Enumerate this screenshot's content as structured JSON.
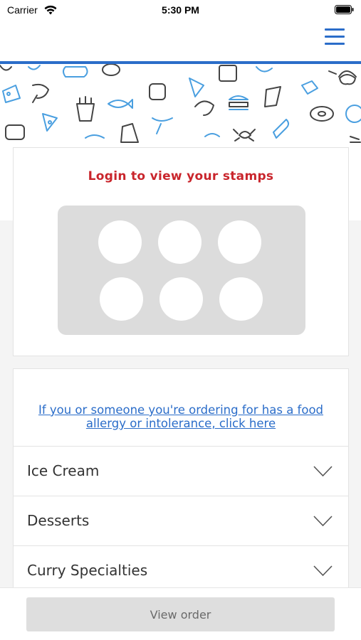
{
  "status_bar": {
    "carrier": "Carrier",
    "time": "5:30 PM",
    "wifi_icon": "wifi-icon",
    "battery_icon": "battery-icon"
  },
  "nav": {
    "menu_icon": "hamburger-menu-icon",
    "accent_color": "#2b6dc9"
  },
  "stamp_card": {
    "login_text": "Login to view your stamps",
    "login_color": "#c9252c",
    "stamp_count": 6,
    "stamps_collected": 0
  },
  "menu_card": {
    "allergy_link": "If you or someone you're ordering for has a food allergy or intolerance, click here",
    "categories": [
      {
        "label": "Ice Cream"
      },
      {
        "label": "Desserts"
      },
      {
        "label": "Curry Specialties"
      }
    ]
  },
  "bottom_bar": {
    "view_order_label": "View order"
  }
}
